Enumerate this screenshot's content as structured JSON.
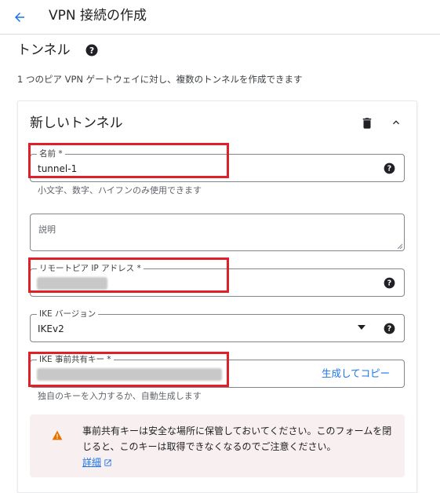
{
  "header": {
    "title": "VPN 接続の作成"
  },
  "section": {
    "title": "トンネル",
    "subtitle": "1 つのピア VPN ゲートウェイに対し、複数のトンネルを作成できます"
  },
  "card": {
    "title": "新しいトンネル"
  },
  "fields": {
    "name": {
      "label": "名前 *",
      "value": "tunnel-1",
      "hint": "小文字、数字、ハイフンのみ使用できます"
    },
    "description": {
      "placeholder": "説明"
    },
    "remote_ip": {
      "label": "リモートピア IP アドレス *"
    },
    "ike_version": {
      "label": "IKE バージョン",
      "value": "IKEv2"
    },
    "psk": {
      "label": "IKE 事前共有キー *",
      "generate_label": "生成してコピー",
      "hint": "独自のキーを入力するか、自動生成します"
    }
  },
  "alert": {
    "text": "事前共有キーは安全な場所に保管しておいてください。このフォームを閉じると、このキーは取得できなくなるのでご注意ください。",
    "link_label": "詳細"
  },
  "colors": {
    "accent": "#1a73e8",
    "highlight": "#e02028",
    "warning": "#e37400"
  }
}
